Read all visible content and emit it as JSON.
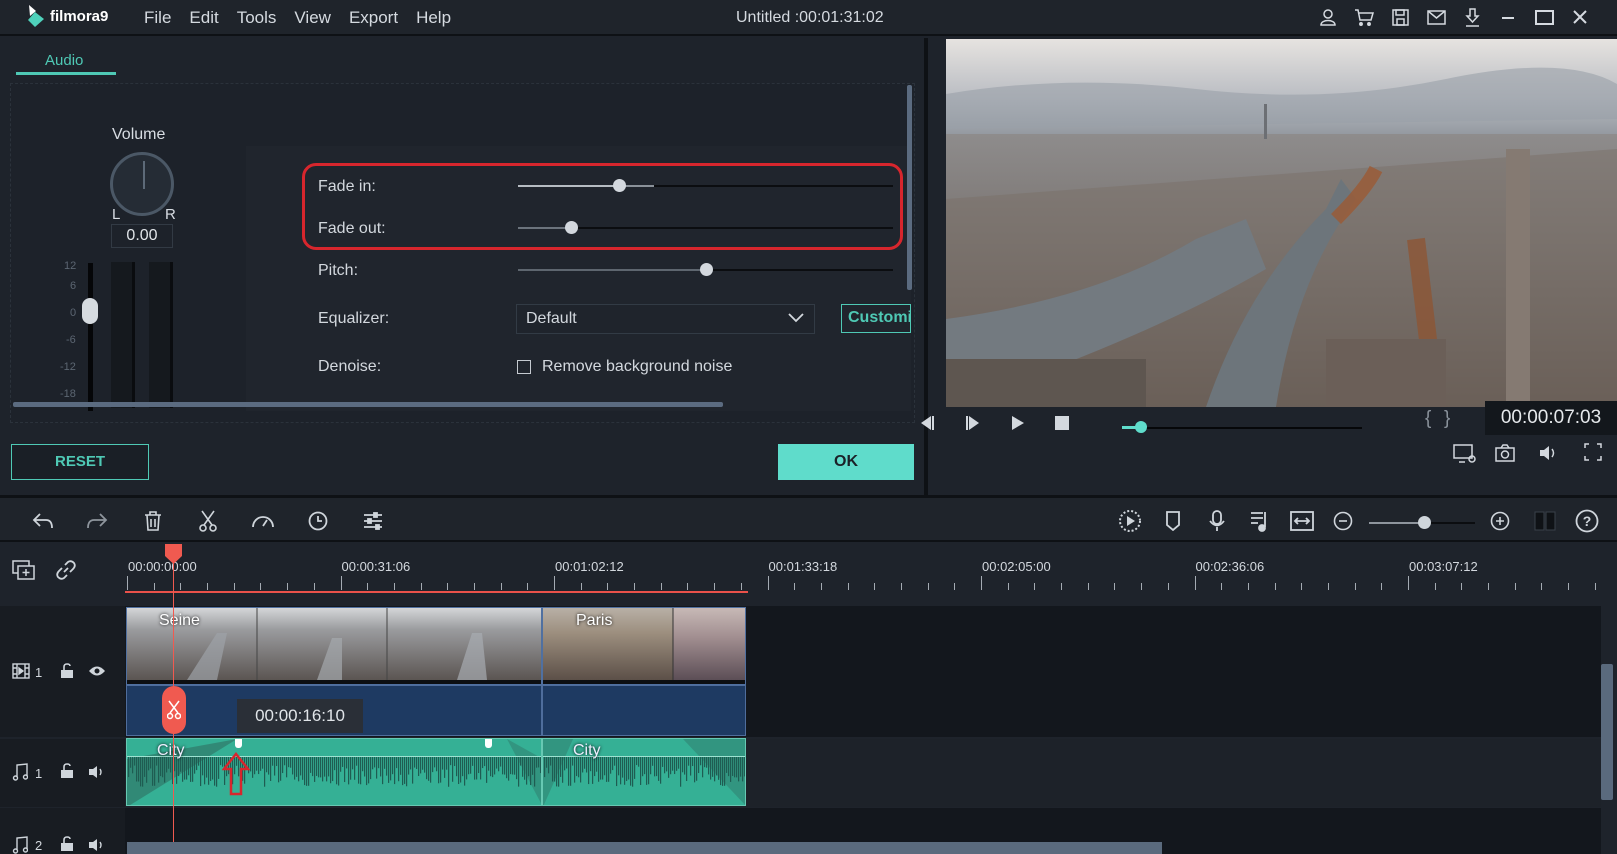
{
  "app": {
    "brand": "filmora9",
    "menu": [
      "File",
      "Edit",
      "Tools",
      "View",
      "Export",
      "Help"
    ],
    "document_title": "Untitled :00:01:31:02",
    "window_icons": [
      "user-icon",
      "cart-icon",
      "save-icon",
      "mail-icon",
      "download-icon",
      "minimize-icon",
      "maximize-icon",
      "close-icon"
    ]
  },
  "audio_panel": {
    "tab": "Audio",
    "volume": {
      "label": "Volume",
      "left_label": "L",
      "right_label": "R",
      "value": "0.00",
      "scale": [
        "12",
        "6",
        "0",
        "-6",
        "-12",
        "-18"
      ],
      "fader_db": 2
    },
    "settings": {
      "fade_in": {
        "label": "Fade in:",
        "value_fraction": 0.27
      },
      "fade_out": {
        "label": "Fade out:",
        "value_fraction": 0.14
      },
      "pitch": {
        "label": "Pitch:",
        "value_fraction": 0.5
      },
      "equalizer": {
        "label": "Equalizer:",
        "selected": "Default",
        "customize_label": "Customi"
      },
      "denoise": {
        "label": "Denoise:",
        "checkbox_label": "Remove background noise",
        "checked": false
      }
    },
    "reset_label": "RESET",
    "ok_label": "OK"
  },
  "preview": {
    "timecode": "00:00:07:03",
    "progress_fraction": 0.08,
    "controls": [
      "prev-frame-icon",
      "next-frame-icon",
      "play-icon",
      "stop-icon"
    ],
    "mark_in": "{",
    "mark_out": "}",
    "bottom_icons": [
      "display-settings-icon",
      "snapshot-icon",
      "volume-icon",
      "fullscreen-icon"
    ]
  },
  "timeline": {
    "toolbar_left": [
      "undo-icon",
      "redo-icon",
      "delete-icon",
      "cut-icon",
      "speed-icon",
      "duration-icon",
      "adjust-icon"
    ],
    "toolbar_right": [
      "render-preview-icon",
      "marker-icon",
      "voiceover-icon",
      "audio-mixer-icon",
      "fit-icon",
      "zoom-out-icon",
      "zoom-in-icon",
      "layout-icon",
      "help-icon"
    ],
    "zoom_fraction": 0.52,
    "ruler": [
      "00:00:00:00",
      "00:00:31:06",
      "00:01:02:12",
      "00:01:33:18",
      "00:02:05:00",
      "00:02:36:06",
      "00:03:07:12"
    ],
    "playhead_time": "00:00:00:00",
    "tooltip": "00:00:16:10",
    "tracks": [
      {
        "type": "video",
        "number": "1",
        "clips": [
          {
            "name": "Seine"
          },
          {
            "name": "Paris"
          }
        ]
      },
      {
        "type": "audio",
        "number": "1",
        "clips": [
          {
            "name": "City"
          },
          {
            "name": "City"
          }
        ]
      },
      {
        "type": "audio",
        "number": "2",
        "clips": []
      }
    ]
  }
}
